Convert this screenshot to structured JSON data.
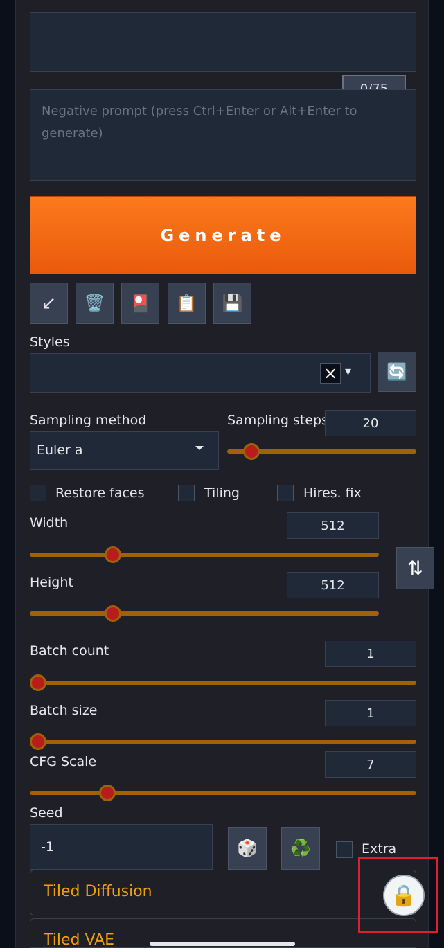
{
  "prompt": {
    "token_counter": "0/75",
    "negative_placeholder": "Negative prompt (press Ctrl+Enter or Alt+Enter to generate)"
  },
  "generate_label": "Generate",
  "tool_buttons": [
    {
      "icon": "arrow-down-left-icon",
      "glyph": "↙"
    },
    {
      "icon": "trash-icon",
      "glyph": "🗑️"
    },
    {
      "icon": "card-icon",
      "glyph": "🎴"
    },
    {
      "icon": "clipboard-icon",
      "glyph": "📋"
    },
    {
      "icon": "save-icon",
      "glyph": "💾"
    }
  ],
  "styles": {
    "label": "Styles",
    "clear_glyph": "×",
    "dropdown_glyph": "▾",
    "refresh_glyph": "🔄"
  },
  "sampling": {
    "method_label": "Sampling method",
    "method_value": "Euler a",
    "steps_label": "Sampling steps",
    "steps_value": "20",
    "steps_fraction": 0.13
  },
  "checkboxes": {
    "restore_faces": "Restore faces",
    "tiling": "Tiling",
    "hires_fix": "Hires. fix"
  },
  "width": {
    "label": "Width",
    "value": "512",
    "fraction": 0.238
  },
  "height": {
    "label": "Height",
    "value": "512",
    "fraction": 0.238
  },
  "swap_glyph": "⇅",
  "batch_count": {
    "label": "Batch count",
    "value": "1",
    "fraction": 0
  },
  "batch_size": {
    "label": "Batch size",
    "value": "1",
    "fraction": 0
  },
  "cfg_scale": {
    "label": "CFG Scale",
    "value": "7",
    "fraction": 0.2
  },
  "seed": {
    "label": "Seed",
    "value": "-1",
    "dice_glyph": "🎲",
    "recycle_glyph": "♻️",
    "extra_label": "Extra"
  },
  "accordions": {
    "tiled_diffusion": "Tiled Diffusion",
    "tiled_vae": "Tiled VAE"
  },
  "lock_glyph": "🔒",
  "colors": {
    "accent_orange": "#f97316",
    "slider_track": "#a16207",
    "slider_thumb": "#b91c1c",
    "highlight_red": "#e11d2e"
  }
}
